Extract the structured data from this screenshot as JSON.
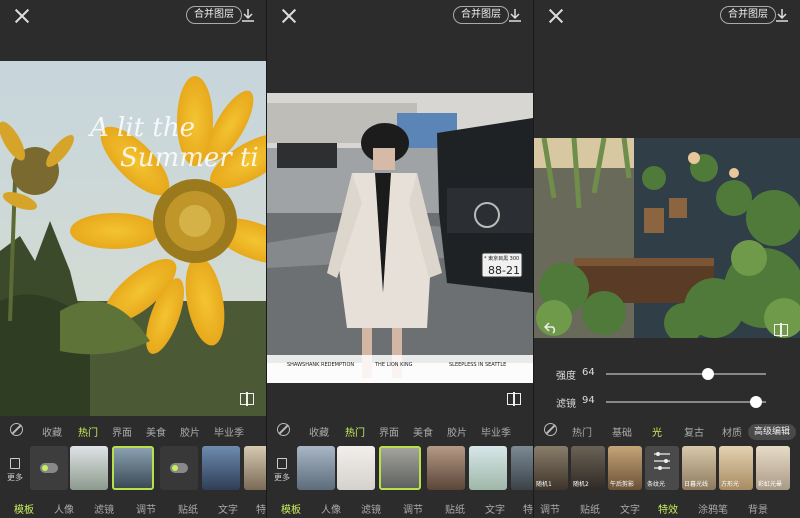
{
  "panels": [
    {
      "merge_label": "合并图层",
      "photo_text_1": "A lit the",
      "photo_text_2": "Summer ti",
      "categories": [
        "收藏",
        "热门",
        "界面",
        "美食",
        "胶片",
        "毕业季"
      ],
      "active_category": "热门",
      "more_label": "更多",
      "tabs": [
        "模板",
        "人像",
        "滤镜",
        "调节",
        "贴纸",
        "文字",
        "特效"
      ],
      "active_tab": "模板"
    },
    {
      "merge_label": "合并图层",
      "plate_top": "* 東京目黒 300",
      "plate_num": "88-21",
      "caption_left": "SHAWSHANK REDEMPTION",
      "caption_mid": "THE LION KING",
      "caption_right": "SLEEPLESS IN SEATTLE",
      "categories": [
        "收藏",
        "热门",
        "界面",
        "美食",
        "胶片",
        "毕业季"
      ],
      "active_category": "热门",
      "more_label": "更多",
      "tabs": [
        "模板",
        "人像",
        "滤镜",
        "调节",
        "贴纸",
        "文字",
        "特效"
      ],
      "active_tab": "模板"
    },
    {
      "merge_label": "合并图层",
      "sliders": [
        {
          "label": "强度",
          "value": "64",
          "fraction": 0.64
        },
        {
          "label": "滤镜",
          "value": "94",
          "fraction": 0.94
        }
      ],
      "categories": [
        "热门",
        "基础",
        "光",
        "复古",
        "材质"
      ],
      "active_category": "光",
      "advanced_label": "高级编辑",
      "effects": [
        "随机1",
        "随机2",
        "午后剪影",
        "条纹光",
        "日暮光线",
        "方形光",
        "彩虹光晕"
      ],
      "tabs": [
        "调节",
        "贴纸",
        "文字",
        "特效",
        "涂鸦笔",
        "背景"
      ],
      "active_tab": "特效"
    }
  ],
  "colors": {
    "accent": "#c7f05a",
    "bg": "#2c2c2c"
  }
}
